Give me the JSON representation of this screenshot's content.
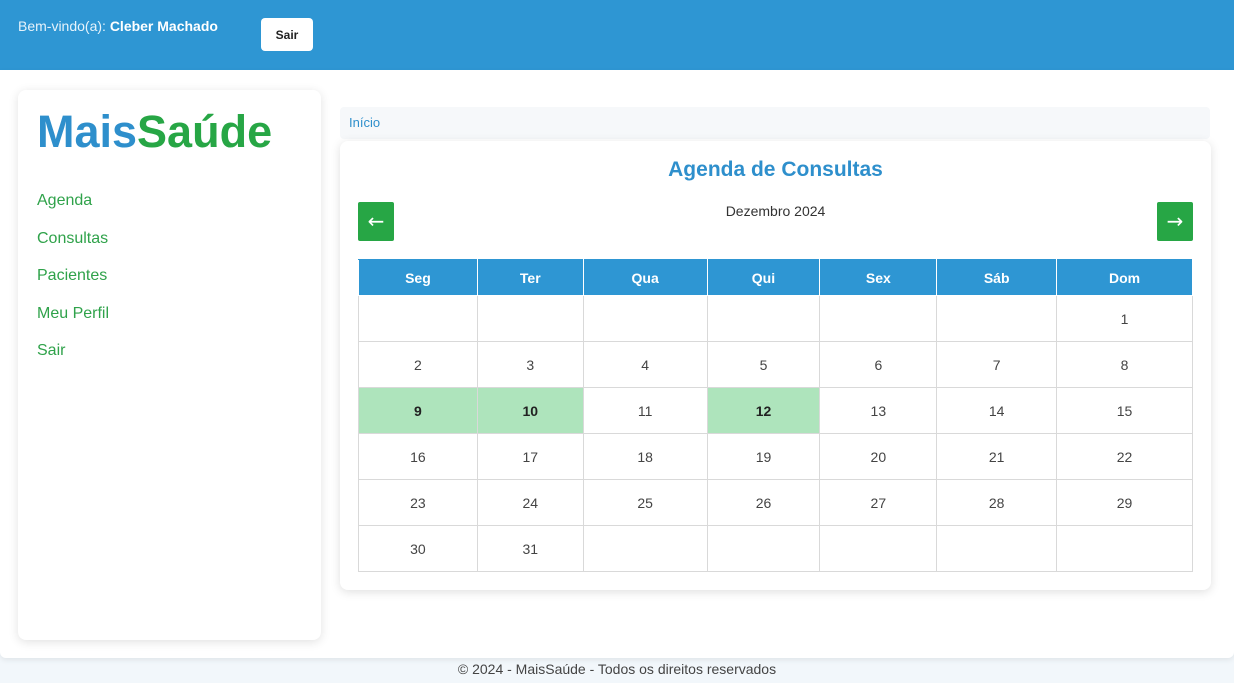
{
  "header": {
    "welcome_prefix": "Bem-vindo(a):",
    "user_name": "Cleber Machado",
    "logout_label": "Sair"
  },
  "sidebar": {
    "brand_part1": "Mais",
    "brand_part2": "Saúde",
    "items": [
      {
        "label": "Agenda"
      },
      {
        "label": "Consultas"
      },
      {
        "label": "Pacientes"
      },
      {
        "label": "Meu Perfil"
      },
      {
        "label": "Sair"
      }
    ]
  },
  "breadcrumb": {
    "home": "Início"
  },
  "calendar": {
    "title": "Agenda de Consultas",
    "month_label": "Dezembro 2024",
    "prev_icon": "←",
    "next_icon": "→",
    "weekdays": [
      "Seg",
      "Ter",
      "Qua",
      "Qui",
      "Sex",
      "Sáb",
      "Dom"
    ],
    "weeks": [
      [
        "",
        "",
        "",
        "",
        "",
        "",
        "1"
      ],
      [
        "2",
        "3",
        "4",
        "5",
        "6",
        "7",
        "8"
      ],
      [
        "9",
        "10",
        "11",
        "12",
        "13",
        "14",
        "15"
      ],
      [
        "16",
        "17",
        "18",
        "19",
        "20",
        "21",
        "22"
      ],
      [
        "23",
        "24",
        "25",
        "26",
        "27",
        "28",
        "29"
      ],
      [
        "30",
        "31",
        "",
        "",
        "",
        "",
        ""
      ]
    ],
    "highlighted_days": [
      "9",
      "10",
      "12"
    ],
    "highlight_color": "#aee4bc",
    "header_color": "#2e96d3",
    "arrow_color": "#27a645"
  },
  "footer": {
    "text": "© 2024 - MaisSaúde - Todos os direitos reservados"
  }
}
